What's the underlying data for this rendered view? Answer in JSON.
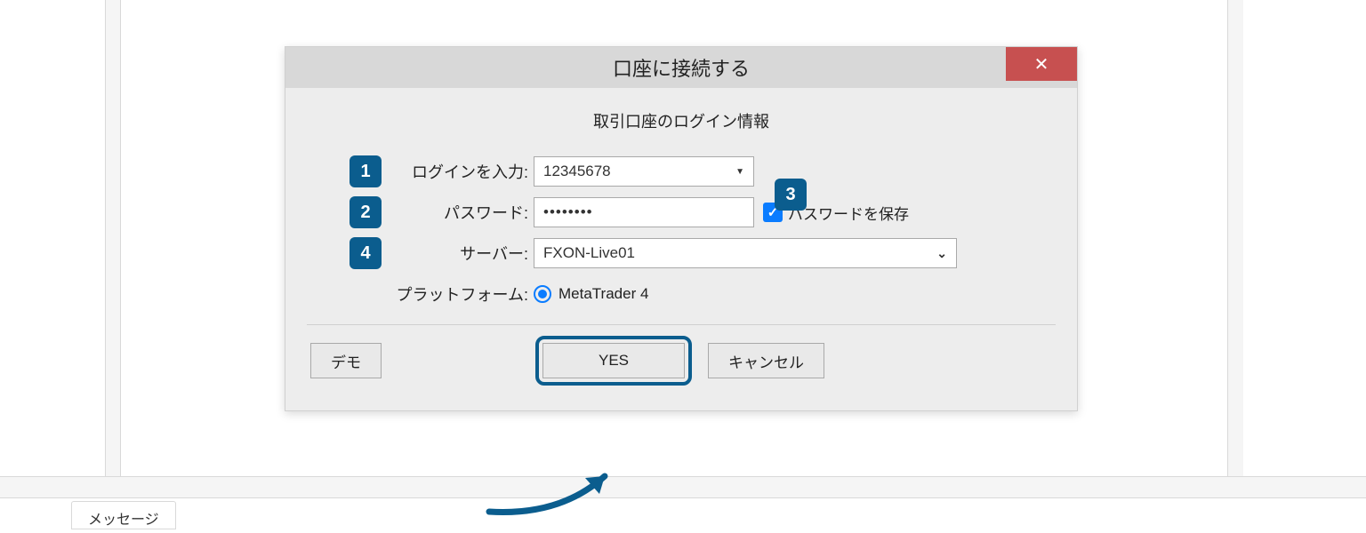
{
  "dialog": {
    "title": "口座に接続する",
    "subtitle": "取引口座のログイン情報",
    "login_label": "ログインを入力:",
    "login_value": "12345678",
    "password_label": "パスワード:",
    "password_mask": "••••••••",
    "save_password_label": "パスワードを保存",
    "save_password_checked": true,
    "server_label": "サーバー:",
    "server_value": "FXON-Live01",
    "platform_label": "プラットフォーム:",
    "platform_value": "MetaTrader 4",
    "buttons": {
      "demo": "デモ",
      "yes": "YES",
      "cancel": "キャンセル"
    }
  },
  "markers": {
    "m1": "1",
    "m2": "2",
    "m3": "3",
    "m4": "4"
  },
  "bottom_tab": "メッセージ"
}
